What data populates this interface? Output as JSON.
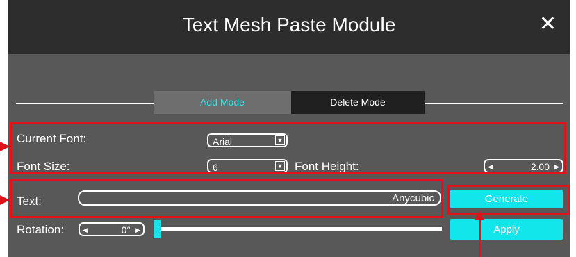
{
  "title": "Text Mesh Paste Module",
  "close_glyph": "✕",
  "tabs": {
    "add": "Add Mode",
    "delete": "Delete Mode"
  },
  "font": {
    "label": "Current Font:",
    "value": "Arial"
  },
  "size": {
    "label": "Font Size:",
    "value": "6"
  },
  "height": {
    "label": "Font Height:",
    "value": "2.00"
  },
  "text": {
    "label": "Text:",
    "value": "Anycubic"
  },
  "rotation": {
    "label": "Rotation:",
    "value": "0°",
    "slider_fraction": 0.0
  },
  "buttons": {
    "generate": "Generate",
    "apply": "Apply"
  },
  "colors": {
    "accent": "#12e6ea",
    "highlight": "#e0121a",
    "panel": "#585858",
    "titlebar": "#2d2d2d"
  },
  "icons": {
    "dropdown": "chevron-down-icon",
    "spin_left": "arrow-left-icon",
    "spin_right": "arrow-right-icon"
  }
}
